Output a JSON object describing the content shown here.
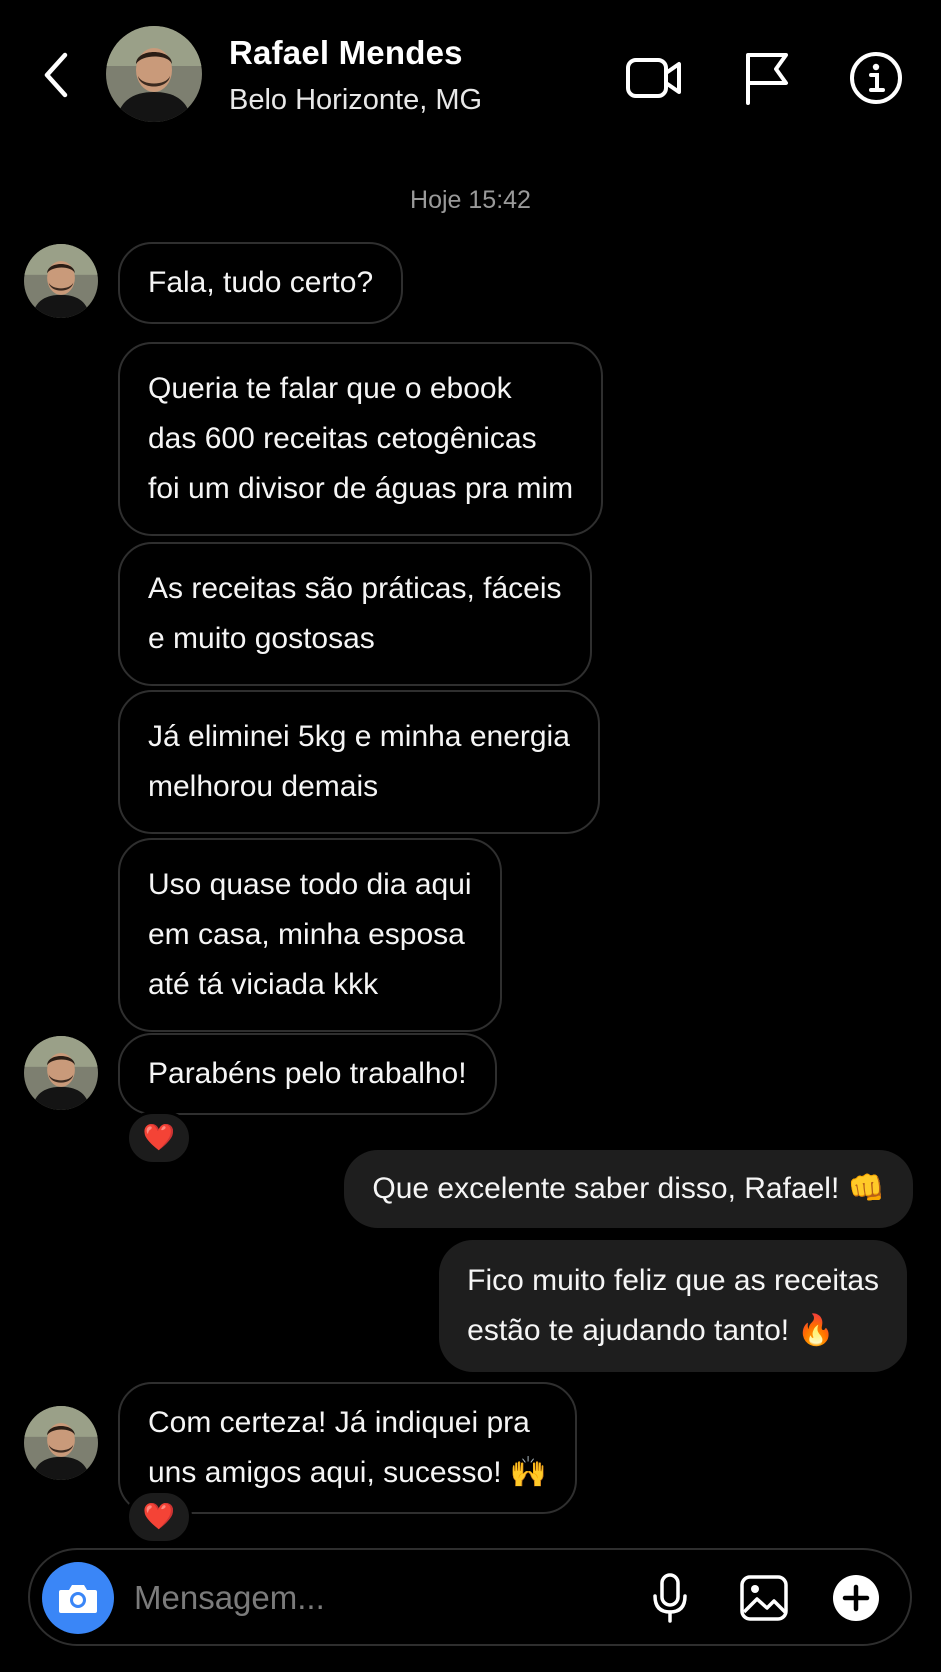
{
  "header": {
    "name": "Rafael Mendes",
    "location": "Belo Horizonte, MG",
    "icons": [
      "back-arrow-icon",
      "avatar",
      "video-call-icon",
      "flag-icon",
      "info-icon"
    ]
  },
  "conversation": {
    "timestamp": "Hoje 15:42",
    "messages": [
      {
        "from": "contact",
        "lines": [
          "Fala, tudo certo?"
        ]
      },
      {
        "from": "contact",
        "lines": [
          "Queria te falar que o ebook",
          "das 600 receitas cetogênicas",
          "foi um divisor de águas pra mim"
        ]
      },
      {
        "from": "contact",
        "lines": [
          "As receitas são práticas, fáceis",
          "e muito gostosas"
        ]
      },
      {
        "from": "contact",
        "lines": [
          "Já eliminei 5kg e minha energia",
          "melhorou demais"
        ]
      },
      {
        "from": "contact",
        "lines": [
          "Uso quase todo dia aqui",
          "em casa, minha esposa",
          "até tá viciada kkk"
        ]
      },
      {
        "from": "contact",
        "lines": [
          "Parabéns pelo trabalho!"
        ],
        "reaction": "❤️"
      },
      {
        "from": "me",
        "lines": [
          "Que excelente saber disso, Rafael! 👊"
        ]
      },
      {
        "from": "me",
        "lines": [
          "Fico muito feliz que as receitas",
          "estão te ajudando tanto! 🔥"
        ]
      },
      {
        "from": "contact",
        "lines": [
          "Com certeza! Já indiquei pra",
          "uns amigos aqui, sucesso! 🙌"
        ],
        "reaction": "❤️"
      }
    ]
  },
  "composer": {
    "placeholder": "Mensagem...",
    "icons": [
      "camera-icon",
      "microphone-icon",
      "gallery-icon",
      "plus-icon"
    ]
  },
  "colors": {
    "background": "#000000",
    "outgoing_bubble": "#1e1e1e",
    "incoming_border": "#2f2f2f",
    "camera_button": "#3a86f7",
    "timestamp": "#9a9a9a"
  }
}
